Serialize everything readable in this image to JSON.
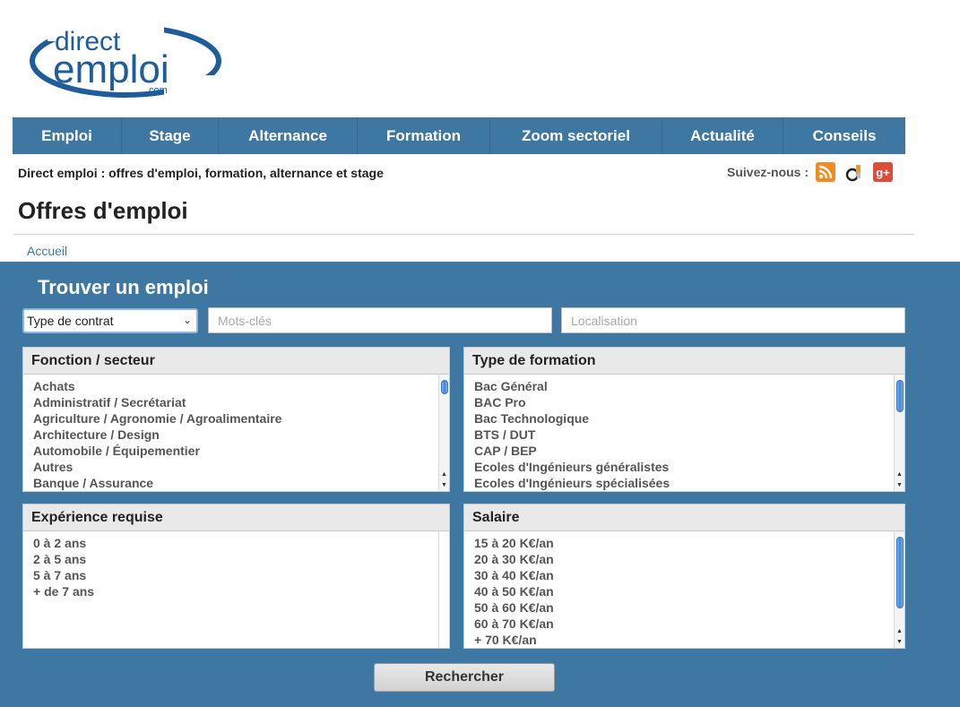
{
  "logo": {
    "line1": "direct",
    "line2": "emploi",
    "suffix": ".com"
  },
  "nav": [
    {
      "label": "Emploi",
      "w": 122
    },
    {
      "label": "Stage",
      "w": 108
    },
    {
      "label": "Alternance",
      "w": 155
    },
    {
      "label": "Formation",
      "w": 148
    },
    {
      "label": "Zoom sectoriel",
      "w": 192
    },
    {
      "label": "Actualité",
      "w": 135
    },
    {
      "label": "Conseils",
      "w": 136
    }
  ],
  "tagline": "Direct emploi : offres d'emploi, formation, alternance et stage",
  "follow": {
    "label": "Suivez-nous :",
    "gplus": "g+"
  },
  "page_title": "Offres d'emploi",
  "breadcrumb": "Accueil",
  "search": {
    "title": "Trouver un emploi",
    "contract_value": "Type de contrat",
    "keywords_placeholder": "Mots-clés",
    "location_placeholder": "Localisation",
    "button": "Rechercher"
  },
  "boxes": {
    "fonction": {
      "title": "Fonction / secteur",
      "items": [
        "Achats",
        "Administratif / Secrétariat",
        "Agriculture / Agronomie / Agroalimentaire",
        "Architecture / Design",
        "Automobile / Équipementier",
        "Autres",
        "Banque / Assurance"
      ]
    },
    "formation": {
      "title": "Type de formation",
      "items": [
        "Bac Général",
        "BAC Pro",
        "Bac Technologique",
        "BTS / DUT",
        "CAP / BEP",
        "Ecoles d'Ingénieurs généralistes",
        "Ecoles d'Ingénieurs spécialisées"
      ]
    },
    "experience": {
      "title": "Expérience requise",
      "items": [
        "0 à 2 ans",
        "2 à 5 ans",
        "5 à 7 ans",
        "+ de 7 ans"
      ]
    },
    "salaire": {
      "title": "Salaire",
      "items": [
        "15 à 20 K€/an",
        "20 à 30 K€/an",
        "30 à 40 K€/an",
        "40 à 50 K€/an",
        "50 à 60 K€/an",
        "60 à 70 K€/an",
        "+ 70 K€/an"
      ]
    }
  },
  "colors": {
    "brand_blue": "#3e77a1",
    "logo_blue": "#1e5c9a",
    "rss": "#f58a1f",
    "gplus": "#dd4b39"
  }
}
